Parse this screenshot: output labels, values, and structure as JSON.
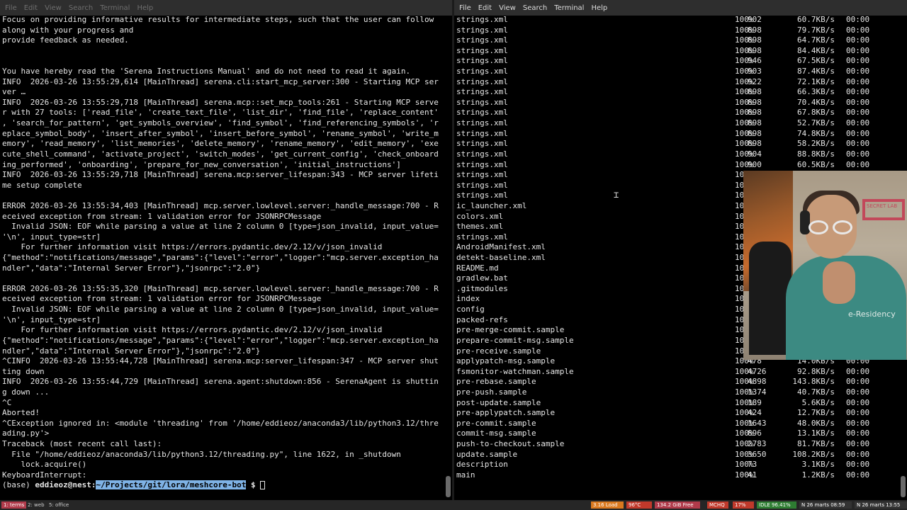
{
  "left_terminal": {
    "menu": [
      "File",
      "Edit",
      "View",
      "Search",
      "Terminal",
      "Help"
    ],
    "lines": [
      "Focus on providing informative results for intermediate steps, such that the user can follow",
      "along with your progress and",
      "provide feedback as needed.",
      "",
      "",
      "You have hereby read the 'Serena Instructions Manual' and do not need to read it again.",
      "INFO  2026-03-26 13:55:29,614 [MainThread] serena.cli:start_mcp_server:300 - Starting MCP ser",
      "ver …",
      "INFO  2026-03-26 13:55:29,718 [MainThread] serena.mcp::set_mcp_tools:261 - Starting MCP serve",
      "r with 27 tools: ['read_file', 'create_text_file', 'list_dir', 'find_file', 'replace_content'",
      ", 'search_for_pattern', 'get_symbols_overview', 'find_symbol', 'find_referencing_symbols', 'r",
      "eplace_symbol_body', 'insert_after_symbol', 'insert_before_symbol', 'rename_symbol', 'write_m",
      "emory', 'read_memory', 'list_memories', 'delete_memory', 'rename_memory', 'edit_memory', 'exe",
      "cute_shell_command', 'activate_project', 'switch_modes', 'get_current_config', 'check_onboard",
      "ing_performed', 'onboarding', 'prepare_for_new_conversation', 'initial_instructions']",
      "INFO  2026-03-26 13:55:29,718 [MainThread] serena.mcp:server_lifespan:343 - MCP server lifeti",
      "me setup complete",
      "",
      "ERROR 2026-03-26 13:55:34,403 [MainThread] mcp.server.lowlevel.server:_handle_message:700 - R",
      "eceived exception from stream: 1 validation error for JSONRPCMessage",
      "  Invalid JSON: EOF while parsing a value at line 2 column 0 [type=json_invalid, input_value=",
      "'\\n', input_type=str]",
      "    For further information visit https://errors.pydantic.dev/2.12/v/json_invalid",
      "{\"method\":\"notifications/message\",\"params\":{\"level\":\"error\",\"logger\":\"mcp.server.exception_ha",
      "ndler\",\"data\":\"Internal Server Error\"},\"jsonrpc\":\"2.0\"}",
      "",
      "ERROR 2026-03-26 13:55:35,320 [MainThread] mcp.server.lowlevel.server:_handle_message:700 - R",
      "eceived exception from stream: 1 validation error for JSONRPCMessage",
      "  Invalid JSON: EOF while parsing a value at line 2 column 0 [type=json_invalid, input_value=",
      "'\\n', input_type=str]",
      "    For further information visit https://errors.pydantic.dev/2.12/v/json_invalid",
      "{\"method\":\"notifications/message\",\"params\":{\"level\":\"error\",\"logger\":\"mcp.server.exception_ha",
      "ndler\",\"data\":\"Internal Server Error\"},\"jsonrpc\":\"2.0\"}",
      "^CINFO  2026-03-26 13:55:44,728 [MainThread] serena.mcp:server_lifespan:347 - MCP server shut",
      "ting down",
      "INFO  2026-03-26 13:55:44,729 [MainThread] serena.agent:shutdown:856 - SerenaAgent is shuttin",
      "g down ...",
      "^C",
      "Aborted!",
      "^CException ignored in: <module 'threading' from '/home/eddieoz/anaconda3/lib/python3.12/thre",
      "ading.py'>",
      "Traceback (most recent call last):",
      "  File \"/home/eddieoz/anaconda3/lib/python3.12/threading.py\", line 1622, in _shutdown",
      "    lock.acquire()",
      "KeyboardInterrupt:"
    ],
    "prompt": {
      "env": "(base) ",
      "user": "eddieoz@nest",
      "sep": ":",
      "path": "~/Projects/git/lora/meshcore-bot",
      "symbol": " $ "
    }
  },
  "right_terminal": {
    "menu": [
      "File",
      "Edit",
      "View",
      "Search",
      "Terminal",
      "Help"
    ],
    "rows": [
      {
        "name": "strings.xml",
        "pct": "100%",
        "size": "902",
        "rate": "60.7KB/s",
        "time": "00:00"
      },
      {
        "name": "strings.xml",
        "pct": "100%",
        "size": "898",
        "rate": "79.7KB/s",
        "time": "00:00"
      },
      {
        "name": "strings.xml",
        "pct": "100%",
        "size": "898",
        "rate": "64.7KB/s",
        "time": "00:00"
      },
      {
        "name": "strings.xml",
        "pct": "100%",
        "size": "898",
        "rate": "84.4KB/s",
        "time": "00:00"
      },
      {
        "name": "strings.xml",
        "pct": "100%",
        "size": "946",
        "rate": "67.5KB/s",
        "time": "00:00"
      },
      {
        "name": "strings.xml",
        "pct": "100%",
        "size": "903",
        "rate": "87.4KB/s",
        "time": "00:00"
      },
      {
        "name": "strings.xml",
        "pct": "100%",
        "size": "922",
        "rate": "72.1KB/s",
        "time": "00:00"
      },
      {
        "name": "strings.xml",
        "pct": "100%",
        "size": "898",
        "rate": "66.3KB/s",
        "time": "00:00"
      },
      {
        "name": "strings.xml",
        "pct": "100%",
        "size": "898",
        "rate": "70.4KB/s",
        "time": "00:00"
      },
      {
        "name": "strings.xml",
        "pct": "100%",
        "size": "898",
        "rate": "67.8KB/s",
        "time": "00:00"
      },
      {
        "name": "strings.xml",
        "pct": "100%",
        "size": "898",
        "rate": "52.7KB/s",
        "time": "00:00"
      },
      {
        "name": "strings.xml",
        "pct": "100%",
        "size": "898",
        "rate": "74.8KB/s",
        "time": "00:00"
      },
      {
        "name": "strings.xml",
        "pct": "100%",
        "size": "898",
        "rate": "58.2KB/s",
        "time": "00:00"
      },
      {
        "name": "strings.xml",
        "pct": "100%",
        "size": "904",
        "rate": "88.8KB/s",
        "time": "00:00"
      },
      {
        "name": "strings.xml",
        "pct": "100%",
        "size": "900",
        "rate": "60.5KB/s",
        "time": "00:00"
      },
      {
        "name": "strings.xml",
        "pct": "10",
        "size": "",
        "rate": "",
        "time": ""
      },
      {
        "name": "strings.xml",
        "pct": "10",
        "size": "",
        "rate": "",
        "time": ""
      },
      {
        "name": "strings.xml",
        "pct": "10",
        "size": "",
        "rate": "",
        "time": ""
      },
      {
        "name": "ic_launcher.xml",
        "pct": "10",
        "size": "",
        "rate": "",
        "time": ""
      },
      {
        "name": "colors.xml",
        "pct": "10",
        "size": "",
        "rate": "",
        "time": ""
      },
      {
        "name": "themes.xml",
        "pct": "10",
        "size": "",
        "rate": "",
        "time": ""
      },
      {
        "name": "strings.xml",
        "pct": "10",
        "size": "",
        "rate": "",
        "time": ""
      },
      {
        "name": "AndroidManifest.xml",
        "pct": "10",
        "size": "",
        "rate": "",
        "time": ""
      },
      {
        "name": "detekt-baseline.xml",
        "pct": "10",
        "size": "",
        "rate": "",
        "time": ""
      },
      {
        "name": "README.md",
        "pct": "10",
        "size": "",
        "rate": "",
        "time": ""
      },
      {
        "name": "gradlew.bat",
        "pct": "10",
        "size": "",
        "rate": "",
        "time": ""
      },
      {
        "name": ".gitmodules",
        "pct": "10",
        "size": "",
        "rate": "",
        "time": ""
      },
      {
        "name": "index",
        "pct": "10",
        "size": "",
        "rate": "",
        "time": ""
      },
      {
        "name": "config",
        "pct": "10",
        "size": "",
        "rate": "",
        "time": ""
      },
      {
        "name": "packed-refs",
        "pct": "10",
        "size": "",
        "rate": "",
        "time": ""
      },
      {
        "name": "pre-merge-commit.sample",
        "pct": "10",
        "size": "",
        "rate": "",
        "time": ""
      },
      {
        "name": "prepare-commit-msg.sample",
        "pct": "10",
        "size": "",
        "rate": "",
        "time": ""
      },
      {
        "name": "pre-receive.sample",
        "pct": "10",
        "size": "",
        "rate": "",
        "time": ""
      },
      {
        "name": "applypatch-msg.sample",
        "pct": "100%",
        "size": "478",
        "rate": "14.0KB/s",
        "time": "00:00"
      },
      {
        "name": "fsmonitor-watchman.sample",
        "pct": "100%",
        "size": "4726",
        "rate": "92.8KB/s",
        "time": "00:00"
      },
      {
        "name": "pre-rebase.sample",
        "pct": "100%",
        "size": "4898",
        "rate": "143.8KB/s",
        "time": "00:00"
      },
      {
        "name": "pre-push.sample",
        "pct": "100%",
        "size": "1374",
        "rate": "40.7KB/s",
        "time": "00:00"
      },
      {
        "name": "post-update.sample",
        "pct": "100%",
        "size": "189",
        "rate": "5.6KB/s",
        "time": "00:00"
      },
      {
        "name": "pre-applypatch.sample",
        "pct": "100%",
        "size": "424",
        "rate": "12.7KB/s",
        "time": "00:00"
      },
      {
        "name": "pre-commit.sample",
        "pct": "100%",
        "size": "1643",
        "rate": "48.0KB/s",
        "time": "00:00"
      },
      {
        "name": "commit-msg.sample",
        "pct": "100%",
        "size": "896",
        "rate": "13.1KB/s",
        "time": "00:00"
      },
      {
        "name": "push-to-checkout.sample",
        "pct": "100%",
        "size": "2783",
        "rate": "81.7KB/s",
        "time": "00:00"
      },
      {
        "name": "update.sample",
        "pct": "100%",
        "size": "3650",
        "rate": "108.2KB/s",
        "time": "00:00"
      },
      {
        "name": "description",
        "pct": "100%",
        "size": "73",
        "rate": "3.1KB/s",
        "time": "00:00"
      },
      {
        "name": "main",
        "pct": "100%",
        "size": "41",
        "rate": "1.2KB/s",
        "time": "00:00"
      }
    ]
  },
  "webcam": {
    "shirt_text": "e-Residency",
    "lamp_text": "SECRET LAB"
  },
  "taskbar": {
    "workspaces": [
      "1: terms",
      "2: web",
      "5: office"
    ],
    "status": [
      "3.16 Load",
      "96°C",
      "134.2 GiB Free",
      "MCHQ",
      "17%",
      "IDLE 96.41%",
      "N 26 marts 08:59",
      "N 26 marts 13:55"
    ]
  },
  "colors": {
    "terminal_bg": "#000000",
    "menubar_bg": "#2e2e2e",
    "prompt_path_bg": "#7fb3e6",
    "workspace_active": "#b03a4a"
  }
}
